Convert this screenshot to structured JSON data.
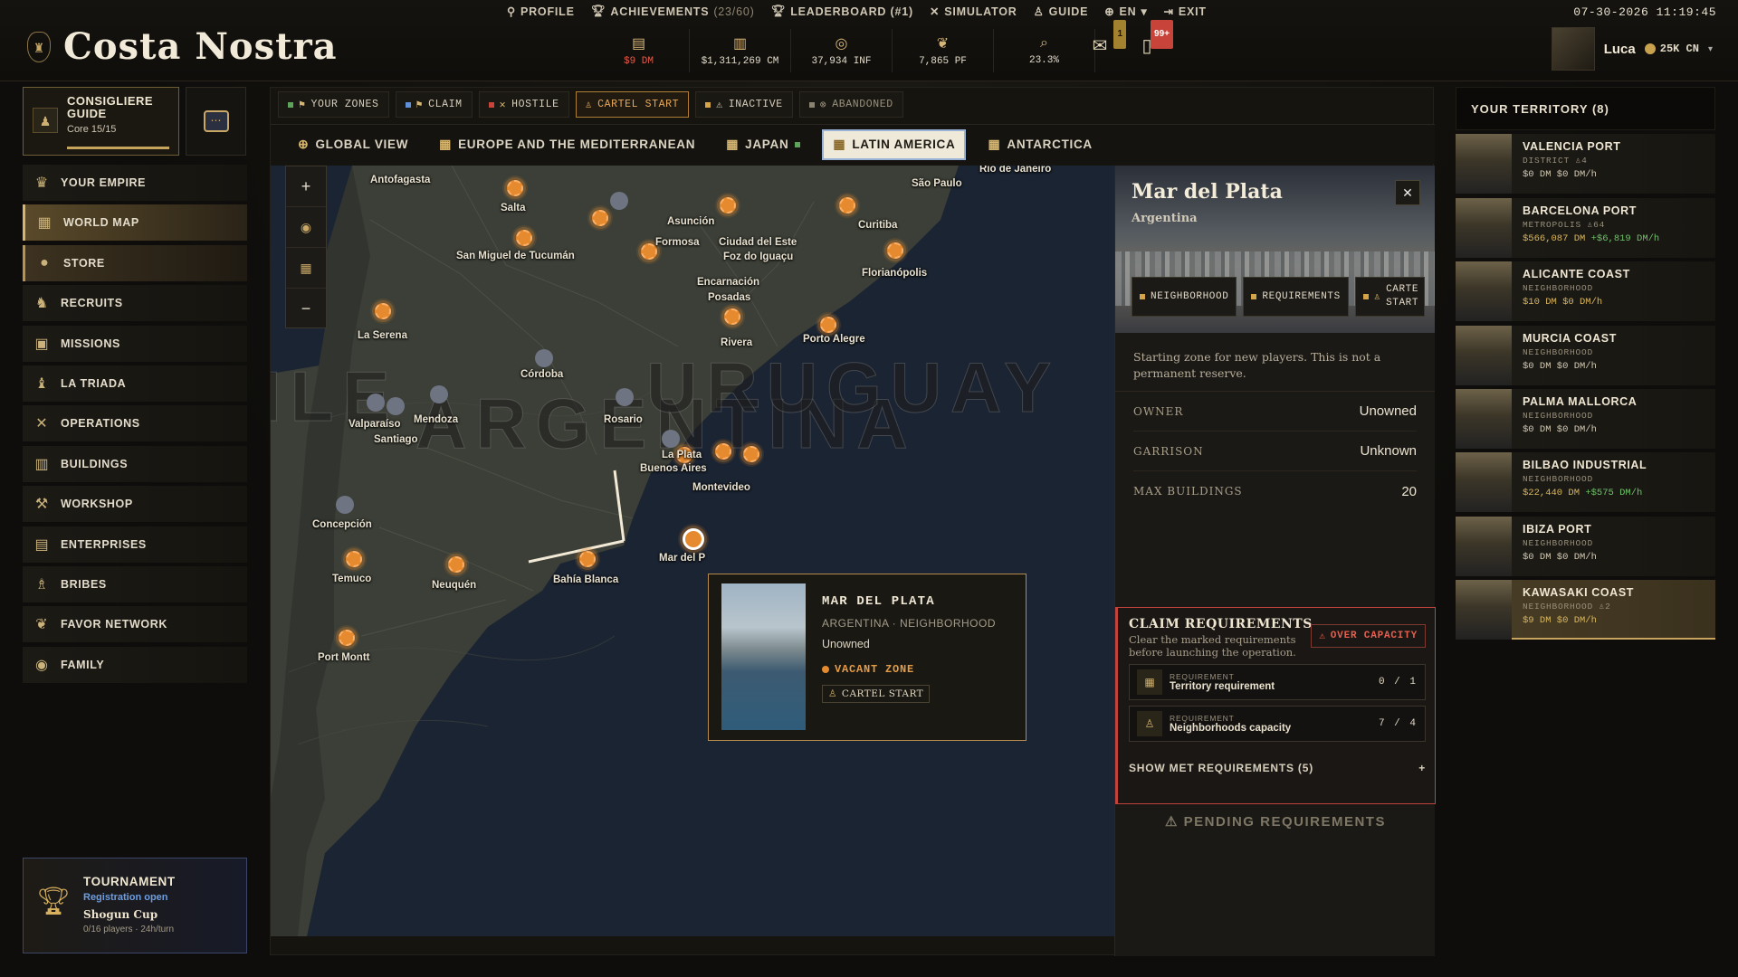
{
  "app": {
    "title": "Costa Nostra",
    "clock": "07-30-2026 11:19:45"
  },
  "topnav": [
    {
      "label": "PROFILE",
      "icon": "user-icon"
    },
    {
      "label": "ACHIEVEMENTS",
      "extra": "(23/60)",
      "icon": "trophy-icon"
    },
    {
      "label": "LEADERBOARD (#1)",
      "icon": "trophy-icon"
    },
    {
      "label": "SIMULATOR",
      "icon": "crossed-swords-icon"
    },
    {
      "label": "GUIDE",
      "icon": "figure-icon"
    },
    {
      "label": "EN",
      "icon": "globe-icon"
    },
    {
      "label": "EXIT",
      "icon": "exit-icon"
    }
  ],
  "resources": [
    {
      "icon": "cash-icon",
      "value": "$9 DM",
      "color": "#e35a4a"
    },
    {
      "icon": "money-stack-icon",
      "value": "$1,311,269 CM"
    },
    {
      "icon": "influence-icon",
      "value": "37,934 INF"
    },
    {
      "icon": "favor-icon",
      "value": "7,865 PF"
    },
    {
      "icon": "magnifier-icon",
      "value": "23.3%"
    }
  ],
  "tray": {
    "mail_badge": "1",
    "phone_badge": "99+"
  },
  "user": {
    "name": "Luca",
    "currency": "25K CN"
  },
  "guide": {
    "title": "CONSIGLIERE GUIDE",
    "sub": "Core 15/15"
  },
  "sidenav": [
    {
      "label": "YOUR EMPIRE",
      "icon": "crown-icon"
    },
    {
      "label": "WORLD MAP",
      "icon": "map-icon",
      "active": true
    },
    {
      "label": "STORE",
      "icon": "coin-icon"
    },
    {
      "label": "RECRUITS",
      "icon": "recruit-icon"
    },
    {
      "label": "MISSIONS",
      "icon": "scroll-icon"
    },
    {
      "label": "LA TRIADA",
      "icon": "dragon-icon"
    },
    {
      "label": "OPERATIONS",
      "icon": "crossed-swords-icon"
    },
    {
      "label": "BUILDINGS",
      "icon": "building-icon"
    },
    {
      "label": "WORKSHOP",
      "icon": "tools-icon"
    },
    {
      "label": "ENTERPRISES",
      "icon": "factory-icon"
    },
    {
      "label": "BRIBES",
      "icon": "bribe-icon"
    },
    {
      "label": "FAVOR NETWORK",
      "icon": "handshake-icon"
    },
    {
      "label": "FAMILY",
      "icon": "family-crest-icon"
    }
  ],
  "tournament": {
    "title": "TOURNAMENT",
    "status": "Registration open",
    "name": "Shogun Cup",
    "meta": "0/16 players · 24h/turn"
  },
  "filters": [
    {
      "label": "YOUR ZONES",
      "color": "#5ea35b"
    },
    {
      "label": "CLAIM",
      "color": "#5f8fd6"
    },
    {
      "label": "HOSTILE",
      "color": "#c8443a"
    },
    {
      "label": "CARTEL START",
      "color": "#e6a85a",
      "active": true
    },
    {
      "label": "INACTIVE",
      "color": "#d4a548"
    },
    {
      "label": "ABANDONED",
      "color": "#8a8372"
    }
  ],
  "regions": [
    {
      "label": "GLOBAL VIEW"
    },
    {
      "label": "EUROPE AND THE MEDITERRANEAN"
    },
    {
      "label": "JAPAN"
    },
    {
      "label": "LATIN AMERICA",
      "active": true
    },
    {
      "label": "ANTARCTICA"
    }
  ],
  "map": {
    "countries": [
      "ARGENTINA",
      "URUGUAY",
      "ILE"
    ],
    "cities": [
      "Antofagasta",
      "Salta",
      "Asunción",
      "Formosa",
      "Ciudad del Este",
      "Foz do Iguaçu",
      "Curitiba",
      "São Paulo",
      "Rio de Janeiro",
      "San Miguel de Tucumán",
      "Florianópolis",
      "Encarnación",
      "Posadas",
      "Porto Alegre",
      "La Serena",
      "Rivera",
      "Córdoba",
      "Valparaíso",
      "Mendoza",
      "Santiago",
      "Rosario",
      "La Plata",
      "Buenos Aires",
      "Montevideo",
      "Concepción",
      "Temuco",
      "Neuquén",
      "Bahía Blanca",
      "Mar del P",
      "Port Montt"
    ]
  },
  "popup": {
    "name": "MAR DEL PLATA",
    "sub": "ARGENTINA · NEIGHBORHOOD",
    "owner": "Unowned",
    "status": "VACANT ZONE",
    "tag": "CARTEL START"
  },
  "detail": {
    "name": "Mar del Plata",
    "country": "Argentina",
    "tabs": [
      "NEIGHBORHOOD",
      "REQUIREMENTS",
      "CARTE START"
    ],
    "desc": "Starting zone for new players. This is not a permanent reserve.",
    "fields": [
      {
        "k": "OWNER",
        "v": "Unowned"
      },
      {
        "k": "GARRISON",
        "v": "Unknown"
      },
      {
        "k": "MAX BUILDINGS",
        "v": "20"
      }
    ],
    "claim": {
      "title": "CLAIM REQUIREMENTS",
      "note": "Clear the marked requirements before launching the operation.",
      "warning": "OVER CAPACITY",
      "reqs": [
        {
          "tag": "REQUIREMENT",
          "label": "Territory requirement",
          "count": "0 / 1"
        },
        {
          "tag": "REQUIREMENT",
          "label": "Neighborhoods capacity",
          "count": "7 / 4"
        }
      ],
      "met": "SHOW MET REQUIREMENTS (5)"
    },
    "pending": "PENDING REQUIREMENTS"
  },
  "territory": {
    "header": "YOUR TERRITORY (8)",
    "items": [
      {
        "name": "VALENCIA PORT",
        "type": "DISTRICT",
        "level": "4",
        "money": "$0 DM $0 DM/h"
      },
      {
        "name": "BARCELONA PORT",
        "type": "METROPOLIS",
        "level": "64",
        "money": "$566,087 DM",
        "income": "+$6,819 DM/h"
      },
      {
        "name": "ALICANTE COAST",
        "type": "NEIGHBORHOOD",
        "level": "",
        "money": "$10 DM $0 DM/h"
      },
      {
        "name": "MURCIA COAST",
        "type": "NEIGHBORHOOD",
        "level": "",
        "money": "$0 DM $0 DM/h"
      },
      {
        "name": "PALMA MALLORCA",
        "type": "NEIGHBORHOOD",
        "level": "",
        "money": "$0 DM $0 DM/h"
      },
      {
        "name": "BILBAO INDUSTRIAL",
        "type": "NEIGHBORHOOD",
        "level": "",
        "money": "$22,440 DM",
        "income": "+$575 DM/h"
      },
      {
        "name": "IBIZA PORT",
        "type": "NEIGHBORHOOD",
        "level": "",
        "money": "$0 DM $0 DM/h"
      },
      {
        "name": "KAWASAKI COAST",
        "type": "NEIGHBORHOOD",
        "level": "2",
        "money": "$9 DM $0 DM/h",
        "selected": true
      }
    ]
  }
}
